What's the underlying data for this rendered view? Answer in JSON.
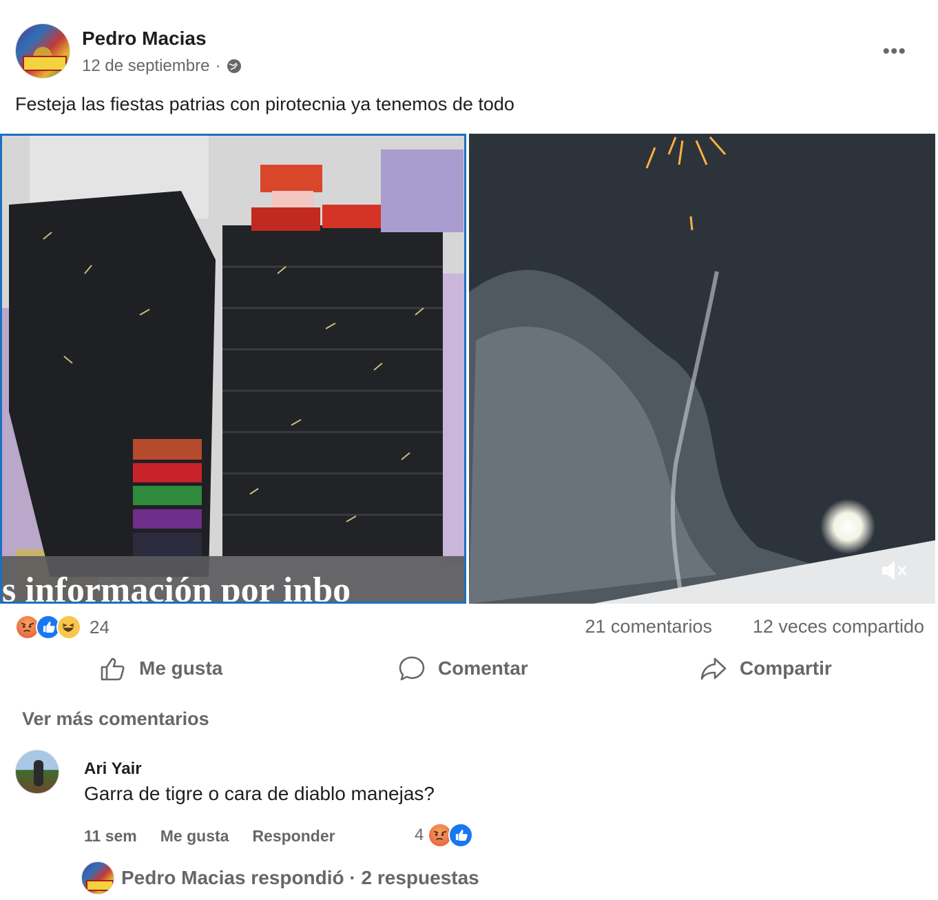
{
  "post": {
    "author": "Pedro Macias",
    "date": "12 de septiembre",
    "separator": "·",
    "text": "Festeja las fiestas patrias con pirotecnia ya tenemos de todo",
    "more": "•••",
    "photo_caption_partial": "s información por inbo"
  },
  "stats": {
    "reaction_count": "24",
    "comments": "21 comentarios",
    "shares": "12 veces compartido"
  },
  "actions": {
    "like": "Me gusta",
    "comment": "Comentar",
    "share": "Compartir"
  },
  "more_comments": "Ver más comentarios",
  "comment": {
    "author": "Ari Yair",
    "text": "Garra de tigre o cara de diablo manejas?",
    "time": "11 sem",
    "like": "Me gusta",
    "reply": "Responder",
    "reaction_count": "4"
  },
  "reply_summary": "Pedro Macias respondió · 2 respuestas",
  "icons": [
    "globe-icon",
    "more-icon",
    "like-icon",
    "comment-icon",
    "share-icon",
    "mute-icon",
    "angry-reaction-icon",
    "like-reaction-icon",
    "haha-reaction-icon"
  ],
  "colors": {
    "accent": "#1877f2",
    "secondary_text": "#65676b",
    "selected_border": "#1d6fbf"
  }
}
